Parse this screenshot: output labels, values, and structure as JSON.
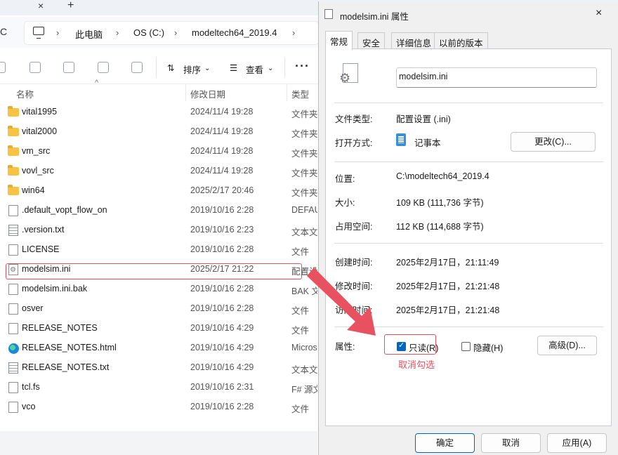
{
  "explorer": {
    "tab_close": "×",
    "tab_new": "+",
    "refresh": "C",
    "breadcrumbs": [
      "此电脑",
      "OS (C:)",
      "modeltech64_2019.4"
    ],
    "toolbar": {
      "sort_label": "排序",
      "view_label": "查看",
      "more": "···"
    },
    "columns": {
      "name": "名称",
      "date": "修改日期",
      "type": "类型"
    },
    "files": [
      {
        "name": "vital1995",
        "date": "2024/11/4 19:28",
        "type": "文件夹",
        "icon": "folder-icon"
      },
      {
        "name": "vital2000",
        "date": "2024/11/4 19:28",
        "type": "文件夹",
        "icon": "folder-icon"
      },
      {
        "name": "vm_src",
        "date": "2024/11/4 19:28",
        "type": "文件夹",
        "icon": "folder-icon"
      },
      {
        "name": "vovl_src",
        "date": "2024/11/4 19:28",
        "type": "文件夹",
        "icon": "folder-icon"
      },
      {
        "name": "win64",
        "date": "2025/2/17 20:46",
        "type": "文件夹",
        "icon": "folder-icon"
      },
      {
        "name": ".default_vopt_flow_on",
        "date": "2019/10/16 2:28",
        "type": "DEFAULT",
        "icon": "file-icon"
      },
      {
        "name": ".version.txt",
        "date": "2019/10/16 2:23",
        "type": "文本文档",
        "icon": "text-file-icon"
      },
      {
        "name": "LICENSE",
        "date": "2019/10/16 2:28",
        "type": "文件",
        "icon": "file-icon"
      },
      {
        "name": "modelsim.ini",
        "date": "2025/2/17 21:22",
        "type": "配置设置",
        "icon": "config-file-icon"
      },
      {
        "name": "modelsim.ini.bak",
        "date": "2019/10/16 2:28",
        "type": "BAK 文件",
        "icon": "file-icon"
      },
      {
        "name": "osver",
        "date": "2019/10/16 2:28",
        "type": "文件",
        "icon": "file-icon"
      },
      {
        "name": "RELEASE_NOTES",
        "date": "2019/10/16 4:29",
        "type": "文件",
        "icon": "file-icon"
      },
      {
        "name": "RELEASE_NOTES.html",
        "date": "2019/10/16 4:29",
        "type": "Microsoft",
        "icon": "edge-icon"
      },
      {
        "name": "RELEASE_NOTES.txt",
        "date": "2019/10/16 4:29",
        "type": "文本文档",
        "icon": "text-file-icon"
      },
      {
        "name": "tcl.fs",
        "date": "2019/10/16 2:31",
        "type": "F# 源文件",
        "icon": "file-icon"
      },
      {
        "name": "vco",
        "date": "2019/10/16 2:28",
        "type": "文件",
        "icon": "file-icon"
      }
    ]
  },
  "dialog": {
    "title": "modelsim.ini 属性",
    "close": "×",
    "tabs": [
      "常规",
      "安全",
      "详细信息",
      "以前的版本"
    ],
    "active_tab": "常规",
    "filename": "modelsim.ini",
    "file_type_label": "文件类型:",
    "file_type_value": "配置设置 (.ini)",
    "open_with_label": "打开方式:",
    "open_with_value": "记事本",
    "change_button": "更改(C)...",
    "location_label": "位置:",
    "location_value": "C:\\modeltech64_2019.4",
    "size_label": "大小:",
    "size_value": "109 KB (111,736 字节)",
    "size_on_disk_label": "占用空间:",
    "size_on_disk_value": "112 KB (114,688 字节)",
    "created_label": "创建时间:",
    "created_value": "2025年2月17日，21:11:49",
    "modified_label": "修改时间:",
    "modified_value": "2025年2月17日，21:21:48",
    "accessed_label": "访问时间:",
    "accessed_value": "2025年2月17日，21:21:48",
    "attributes_label": "属性:",
    "readonly_label": "只读(R)",
    "readonly_checked": true,
    "hidden_label": "隐藏(H)",
    "hidden_checked": false,
    "advanced_button": "高级(D)...",
    "annotation": "取消勾选",
    "ok_button": "确定",
    "cancel_button": "取消",
    "apply_button": "应用(A)"
  },
  "colors": {
    "annotation_red": "#e8515f",
    "accent_blue": "#0067c0",
    "folder_yellow": "#f6c344"
  }
}
